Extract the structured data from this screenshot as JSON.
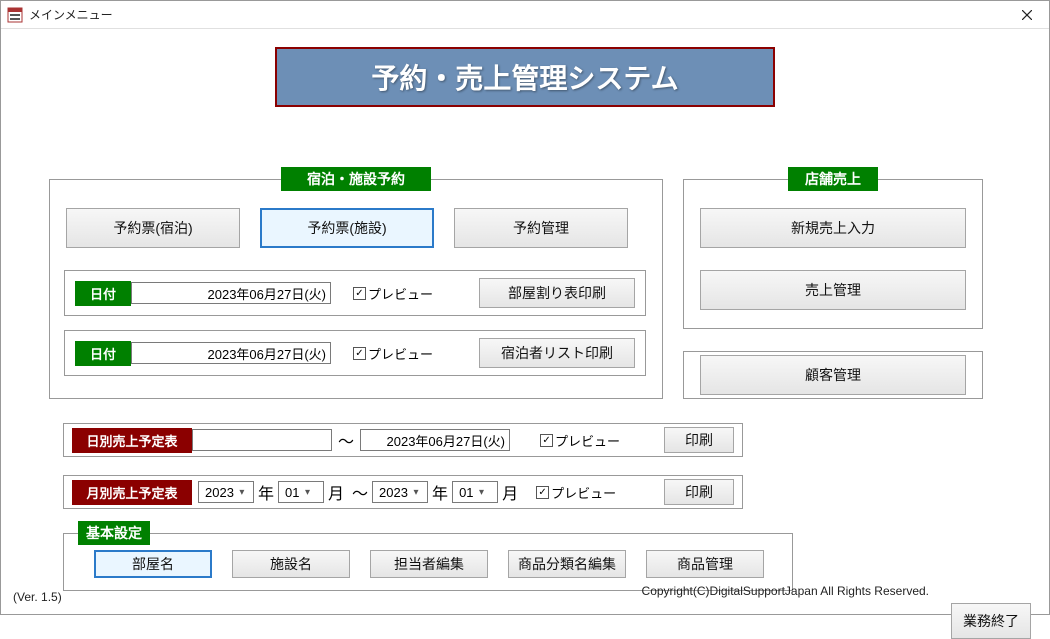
{
  "window": {
    "title": "メインメニュー"
  },
  "header": {
    "main_title": "予約・売上管理システム"
  },
  "reservation": {
    "group_label": "宿泊・施設予約",
    "btn_stay": "予約票(宿泊)",
    "btn_facility": "予約票(施設)",
    "btn_manage": "予約管理",
    "row1": {
      "date_label": "日付",
      "date_value": "2023年06月27日(火)",
      "preview_label": "プレビュー",
      "print_btn": "部屋割り表印刷"
    },
    "row2": {
      "date_label": "日付",
      "date_value": "2023年06月27日(火)",
      "preview_label": "プレビュー",
      "print_btn": "宿泊者リスト印刷"
    }
  },
  "sales": {
    "group_label": "店舗売上",
    "btn_new": "新規売上入力",
    "btn_manage": "売上管理",
    "btn_customer": "顧客管理"
  },
  "daily": {
    "label": "日別売上予定表",
    "from_value": "",
    "tilde": "～",
    "to_value": "2023年06月27日(火)",
    "preview_label": "プレビュー",
    "print_btn": "印刷"
  },
  "monthly": {
    "label": "月別売上予定表",
    "from_year": "2023",
    "from_month": "01",
    "to_year": "2023",
    "to_month": "01",
    "year_suffix": "年",
    "month_suffix": "月",
    "tilde": "～",
    "preview_label": "プレビュー",
    "print_btn": "印刷"
  },
  "settings": {
    "group_label": "基本設定",
    "btn_room": "部屋名",
    "btn_facility": "施設名",
    "btn_staff": "担当者編集",
    "btn_category": "商品分類名編集",
    "btn_product": "商品管理"
  },
  "footer": {
    "version": "(Ver. 1.5)",
    "copyright": "Copyright(C)DigitalSupportJapan All Rights Reserved.",
    "exit_btn": "業務終了"
  }
}
